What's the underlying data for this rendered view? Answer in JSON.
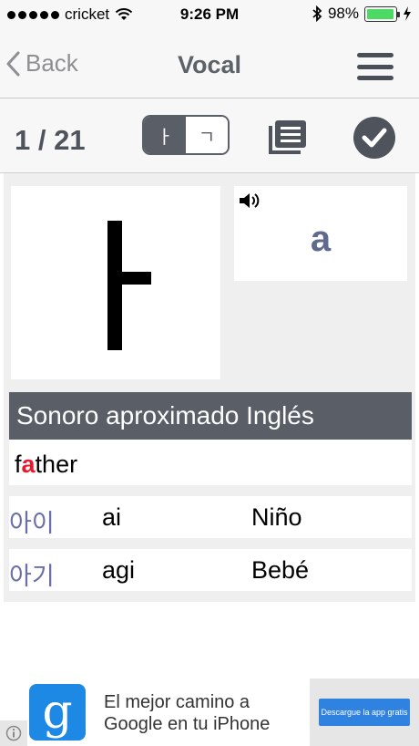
{
  "status_bar": {
    "carrier": "cricket",
    "time": "9:26 PM",
    "battery_percent": "98%",
    "battery_level": 0.98,
    "signal_dots": 5
  },
  "nav": {
    "back_label": "Back",
    "title": "Vocal"
  },
  "toolbar": {
    "counter": "1 / 21",
    "segment_left": "ㅏ",
    "segment_right": "ㄱ",
    "icons": [
      "list-icon",
      "checkmark-icon"
    ]
  },
  "card": {
    "character": "ㅏ",
    "romanization": "a"
  },
  "section": {
    "header": "Sonoro aproximado Inglés",
    "example_prefix": "f",
    "example_highlight": "a",
    "example_suffix": "ther"
  },
  "words": [
    {
      "hangul": "아이",
      "roman": "ai",
      "translation": "Niño"
    },
    {
      "hangul": "아기",
      "roman": "agi",
      "translation": "Bebé"
    }
  ],
  "ad": {
    "logo_letter": "g",
    "line1": "El mejor camino a",
    "line2": "Google en tu iPhone",
    "button_label": "Descargue la app gratis"
  },
  "colors": {
    "accent": "#5a5f67",
    "highlight": "#e8192c",
    "hangul": "#6b6fa8",
    "battery": "#4cd964",
    "ad_button": "#2f82e0"
  }
}
